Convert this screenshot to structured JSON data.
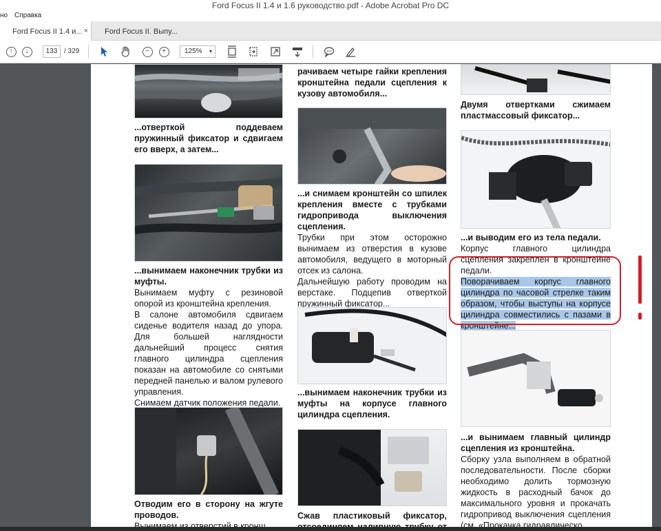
{
  "window": {
    "title": "Ford Focus II 1.4 и 1.6 руководство.pdf - Adobe Acrobat Pro DC"
  },
  "menu": {
    "items": [
      "но",
      "Справка"
    ]
  },
  "tabs": [
    {
      "label": "Ford Focus II 1.4 и...",
      "close": "×"
    },
    {
      "label": "Ford Focus II. Выпу..."
    }
  ],
  "toolbar": {
    "page_current": "133",
    "page_separator": "/ 329",
    "zoom": "125%",
    "zoom_arrow": "▾"
  },
  "colors": {
    "highlight": "#a9c7e8",
    "annotation_red": "#d21f27",
    "photo_border": "#cfd6df"
  },
  "icons": [
    "arrow-up-circle-icon",
    "arrow-down-circle-icon",
    "pointer-icon",
    "hand-icon",
    "zoom-out-icon",
    "zoom-in-icon",
    "fit-page-icon",
    "rotate-icon",
    "fullscreen-icon",
    "scroll-mode-icon",
    "comment-icon",
    "sign-icon"
  ],
  "col1": {
    "cap1": "...отверткой поддеваем пружинный фиксатор и сдвигаем его вверх, а затем...",
    "cap2": "...вынимаем наконечник трубки из муфты.",
    "text2": "Вынимаем муфту с резиновой опорой из кронштейна крепления.",
    "text3": "В салоне автомобиля сдвигаем сиденье водителя назад до упора. Для большей наглядности дальнейший процесс снятия главного цилиндра сцепления показан на автомобиле со снятыми передней панелью и валом рулевого управления.",
    "text4": "Снимаем датчик положения педали.",
    "cap3": "Отводим его в сторону на жгуте проводов.",
    "text5": "Вынимаем из отверстий в кронш..."
  },
  "col2": {
    "cap0": "рачиваем четыре гайки крепления кронштейна педали сцепления к кузову автомобиля...",
    "cap1": "...и снимаем кронштейн со шпилек крепления вместе с трубками гидропривода выключения сцепления.",
    "text1": "Трубки при этом осторожно вынимаем из отверстия в кузове автомобиля, ведущего в моторный отсек из салона.",
    "text2": "Дальнейшую работу проводим на верстаке. Подцепив отверткой пружинный фиксатор...",
    "cap2": "...вынимаем наконечник трубки из муфты на корпусе главного цилиндра сцепления.",
    "cap3": "Сжав пластиковый фиксатор, отсоединяем наливную трубку от шту..."
  },
  "col3": {
    "cap0": "Двумя отвертками сжимаем пластмассовый фиксатор...",
    "cap1": "...и выводим его из тела педали.",
    "text1": "Корпус главного цилиндра сцепления закреплен в кронштейне педали.",
    "text1_hl": "Поворачиваем корпус главного цилиндра по часовой стрелке таким образом, чтобы выступы на корпусе цилиндра совместились с пазами в кронштейне...",
    "cap2": "...и вынимаем главный цилиндр сцепления из кронштейна.",
    "text2": "Сборку узла выполняем в обратной последовательности. После сборки необходимо долить тормозную жидкость в расходный бачок до максимального уровня и прокачать гидропривод выключения сцепления (см. «Прокачка гидравлическо..."
  }
}
